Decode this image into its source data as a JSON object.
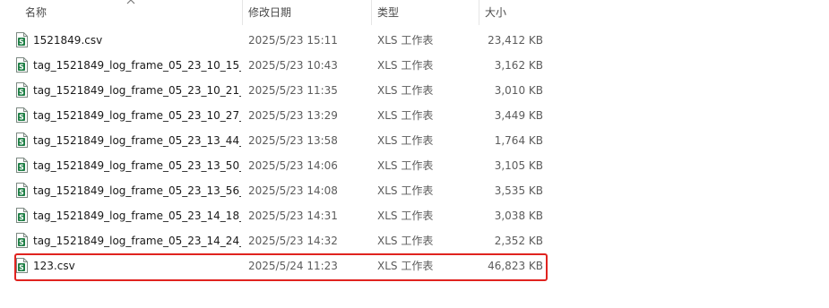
{
  "columns": {
    "name": "名称",
    "date": "修改日期",
    "type": "类型",
    "size": "大小"
  },
  "sort": {
    "column": "name",
    "icon": "sort-up-chevron-icon"
  },
  "file_icon": {
    "name": "spreadsheet-file-icon",
    "glyph": "S",
    "color": "#1e7f45"
  },
  "files": [
    {
      "name": "1521849.csv",
      "date": "2025/5/23 15:11",
      "type": "XLS 工作表",
      "size": "23,412 KB"
    },
    {
      "name": "tag_1521849_log_frame_05_23_10_15_...",
      "date": "2025/5/23 10:43",
      "type": "XLS 工作表",
      "size": "3,162 KB"
    },
    {
      "name": "tag_1521849_log_frame_05_23_10_21_...",
      "date": "2025/5/23 11:35",
      "type": "XLS 工作表",
      "size": "3,010 KB"
    },
    {
      "name": "tag_1521849_log_frame_05_23_10_27_...",
      "date": "2025/5/23 13:29",
      "type": "XLS 工作表",
      "size": "3,449 KB"
    },
    {
      "name": "tag_1521849_log_frame_05_23_13_44_...",
      "date": "2025/5/23 13:58",
      "type": "XLS 工作表",
      "size": "1,764 KB"
    },
    {
      "name": "tag_1521849_log_frame_05_23_13_50_...",
      "date": "2025/5/23 14:06",
      "type": "XLS 工作表",
      "size": "3,105 KB"
    },
    {
      "name": "tag_1521849_log_frame_05_23_13_56_...",
      "date": "2025/5/23 14:08",
      "type": "XLS 工作表",
      "size": "3,535 KB"
    },
    {
      "name": "tag_1521849_log_frame_05_23_14_18_...",
      "date": "2025/5/23 14:31",
      "type": "XLS 工作表",
      "size": "3,038 KB"
    },
    {
      "name": "tag_1521849_log_frame_05_23_14_24_...",
      "date": "2025/5/23 14:32",
      "type": "XLS 工作表",
      "size": "2,352 KB"
    },
    {
      "name": "123.csv",
      "date": "2025/5/24 11:23",
      "type": "XLS 工作表",
      "size": "46,823 KB"
    }
  ],
  "highlight": {
    "file": "123.csv",
    "color": "#e0231f"
  }
}
